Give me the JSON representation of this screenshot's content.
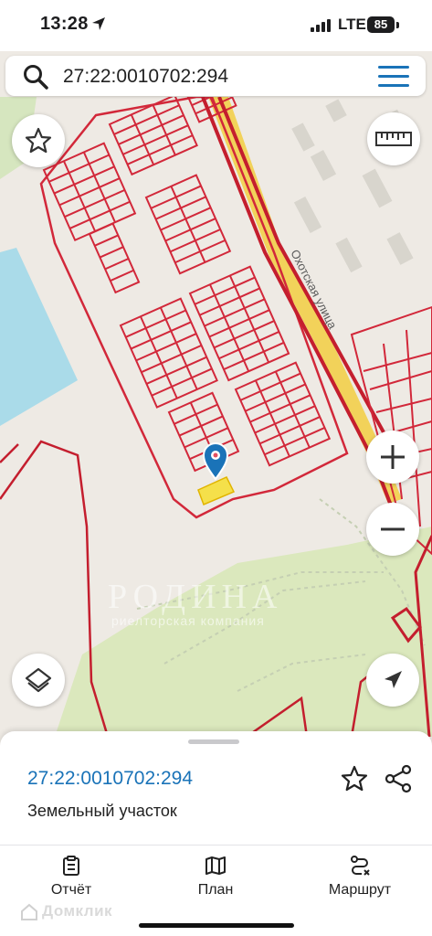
{
  "status_bar": {
    "time": "13:28",
    "network": "LTE",
    "battery": "85"
  },
  "search": {
    "query": "27:22:0010702:294"
  },
  "map": {
    "street_label": "Охотская улица",
    "watermark_title": "РОДИНА",
    "watermark_subtitle": "риелторская компания",
    "colors": {
      "parcel_border": "#d2283a",
      "water": "#aadbe9",
      "forest": "#dbe8bd",
      "road": "#f2d25a",
      "selected": "#f5e04a"
    }
  },
  "map_controls": {
    "favorite_icon": "star-icon",
    "ruler_icon": "ruler-icon",
    "zoom_in_icon": "plus-icon",
    "zoom_out_icon": "minus-icon",
    "layers_icon": "layers-icon",
    "locate_icon": "navigation-arrow-icon"
  },
  "sheet": {
    "title": "27:22:0010702:294",
    "subtitle": "Земельный участок"
  },
  "tabs": [
    {
      "label": "Отчёт",
      "icon": "report-icon"
    },
    {
      "label": "План",
      "icon": "map-plan-icon"
    },
    {
      "label": "Маршрут",
      "icon": "route-icon"
    }
  ],
  "footer_watermark": "Домклик"
}
